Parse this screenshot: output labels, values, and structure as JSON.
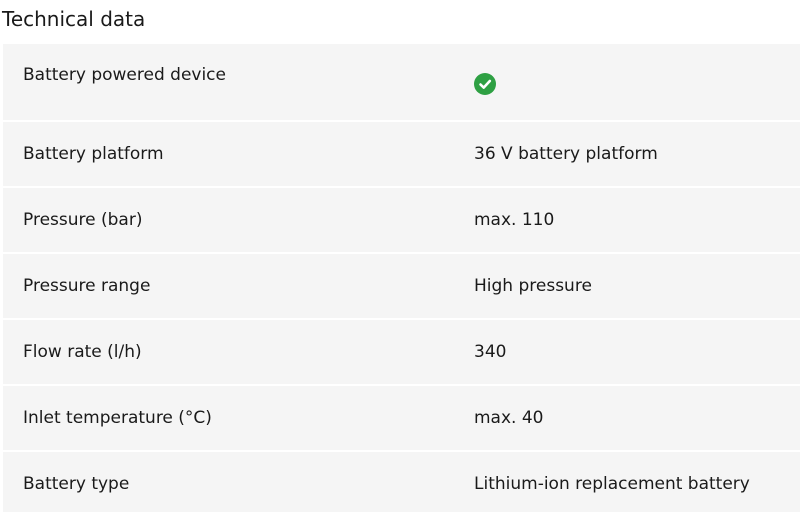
{
  "title": "Technical data",
  "colors": {
    "row_background": "#f5f5f5",
    "check_green": "#2ea043"
  },
  "rows": [
    {
      "label": "Battery powered device",
      "value": "",
      "icon": "check-circle-icon"
    },
    {
      "label": "Battery platform",
      "value": "36 V battery platform"
    },
    {
      "label": "Pressure (bar)",
      "value": "max. 110"
    },
    {
      "label": "Pressure range",
      "value": "High pressure"
    },
    {
      "label": "Flow rate (l/h)",
      "value": "340"
    },
    {
      "label": "Inlet temperature (°C)",
      "value": "max. 40"
    },
    {
      "label": "Battery type",
      "value": "Lithium-ion replacement battery"
    }
  ]
}
